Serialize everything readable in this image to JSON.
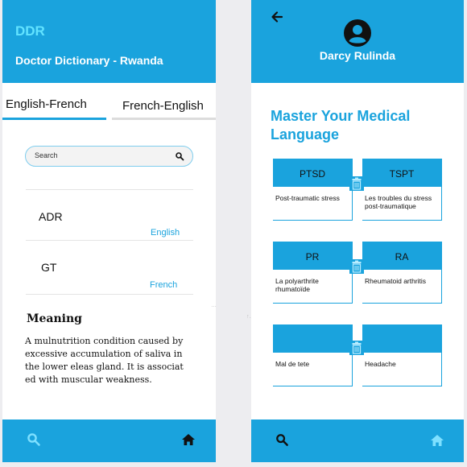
{
  "left": {
    "header": {
      "app_short": "DDR",
      "app_full": "Doctor Dictionary - Rwanda"
    },
    "tabs": [
      {
        "label": "English-French",
        "active": true
      },
      {
        "label": "French-English",
        "active": false
      }
    ],
    "search": {
      "placeholder": "Search"
    },
    "results": [
      {
        "term": "ADR",
        "language": "English"
      },
      {
        "term": "GT",
        "language": "French"
      }
    ],
    "meaning": {
      "title": "Meaning",
      "lines": [
        "A mulnutrition condition  caused by",
        "excessive accumulation of saliva in",
        "the lower eleas gland. It is associat",
        "ed with muscular weakness."
      ]
    },
    "footer": {
      "left_icon": "search-icon",
      "right_icon": "home-icon"
    }
  },
  "right": {
    "header": {
      "user_name": "Darcy Rulinda",
      "back_icon": "arrow-left-icon",
      "avatar_icon": "user-avatar-icon"
    },
    "title_lines": [
      "Master Your Medical",
      "Language"
    ],
    "cards": [
      {
        "abbr": "PTSD",
        "definition": "Post-traumatic stress"
      },
      {
        "abbr": "TSPT",
        "definition": "Les troubles du stress post-traumatique"
      },
      {
        "abbr": "PR",
        "definition": "La polyarthrite rhumatoïde"
      },
      {
        "abbr": "RA",
        "definition": "Rheumatoid arthritis"
      },
      {
        "abbr": "",
        "definition": "Mal de tete"
      },
      {
        "abbr": "",
        "definition": "Headache"
      }
    ],
    "footer": {
      "left_icon": "search-icon",
      "right_icon": "home-icon"
    }
  },
  "colors": {
    "primary": "#1aa3dd",
    "accent_text": "#62e3ff",
    "background": "#ededf0"
  }
}
